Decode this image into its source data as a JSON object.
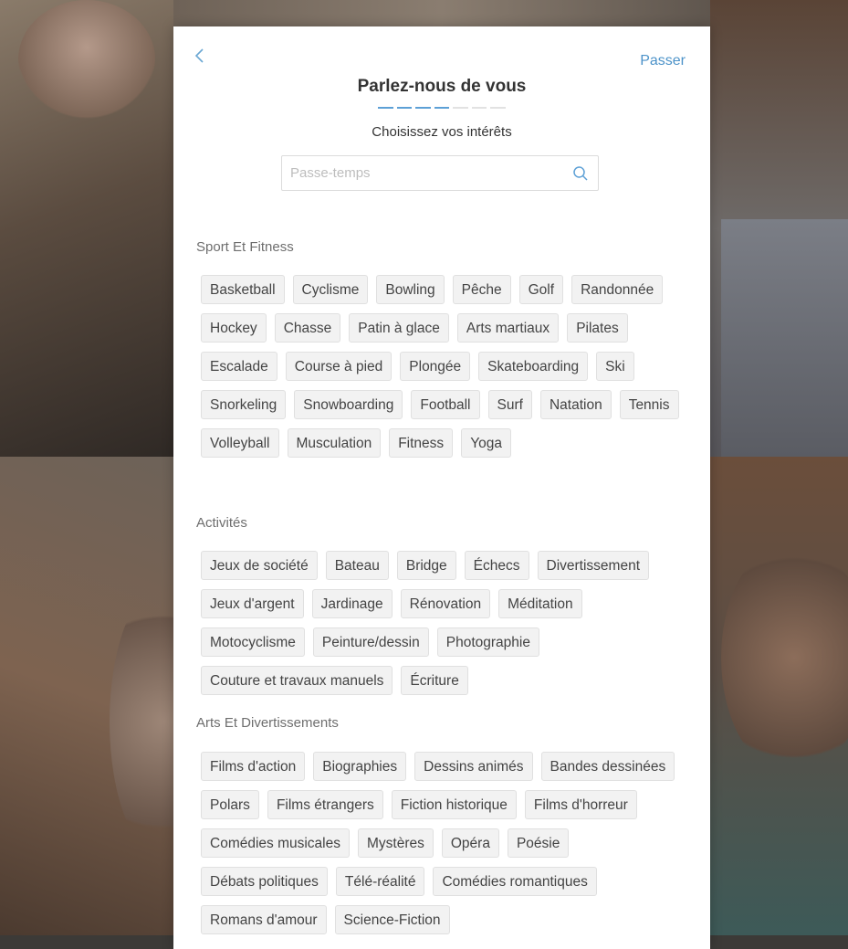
{
  "header": {
    "skip_label": "Passer",
    "title": "Parlez-nous de vous",
    "subtitle": "Choisissez vos intérêts",
    "progress": {
      "steps": 7,
      "completed": 4
    }
  },
  "search": {
    "placeholder": "Passe-temps",
    "value": ""
  },
  "sections": [
    {
      "title": "Sport Et Fitness",
      "items": [
        "Basketball",
        "Cyclisme",
        "Bowling",
        "Pêche",
        "Golf",
        "Randonnée",
        "Hockey",
        "Chasse",
        "Patin à glace",
        "Arts martiaux",
        "Pilates",
        "Escalade",
        "Course à pied",
        "Plongée",
        "Skateboarding",
        "Ski",
        "Snorkeling",
        "Snowboarding",
        "Football",
        "Surf",
        "Natation",
        "Tennis",
        "Volleyball",
        "Musculation",
        "Fitness",
        "Yoga"
      ]
    },
    {
      "title": "Activités",
      "items": [
        "Jeux de société",
        "Bateau",
        "Bridge",
        "Échecs",
        "Divertissement",
        "Jeux d'argent",
        "Jardinage",
        "Rénovation",
        "Méditation",
        "Motocyclisme",
        "Peinture/dessin",
        "Photographie",
        "Couture et travaux manuels",
        "Écriture"
      ]
    },
    {
      "title": "Arts Et Divertissements",
      "items": [
        "Films d'action",
        "Biographies",
        "Dessins animés",
        "Bandes dessinées",
        "Polars",
        "Films étrangers",
        "Fiction historique",
        "Films d'horreur",
        "Comédies musicales",
        "Mystères",
        "Opéra",
        "Poésie",
        "Débats politiques",
        "Télé-réalité",
        "Comédies romantiques",
        "Romans d'amour",
        "Science-Fiction"
      ]
    }
  ],
  "colors": {
    "accent": "#4d93c9",
    "chip_bg": "#f2f2f2"
  },
  "icons": {
    "back": "chevron-left-icon",
    "search": "search-icon"
  }
}
